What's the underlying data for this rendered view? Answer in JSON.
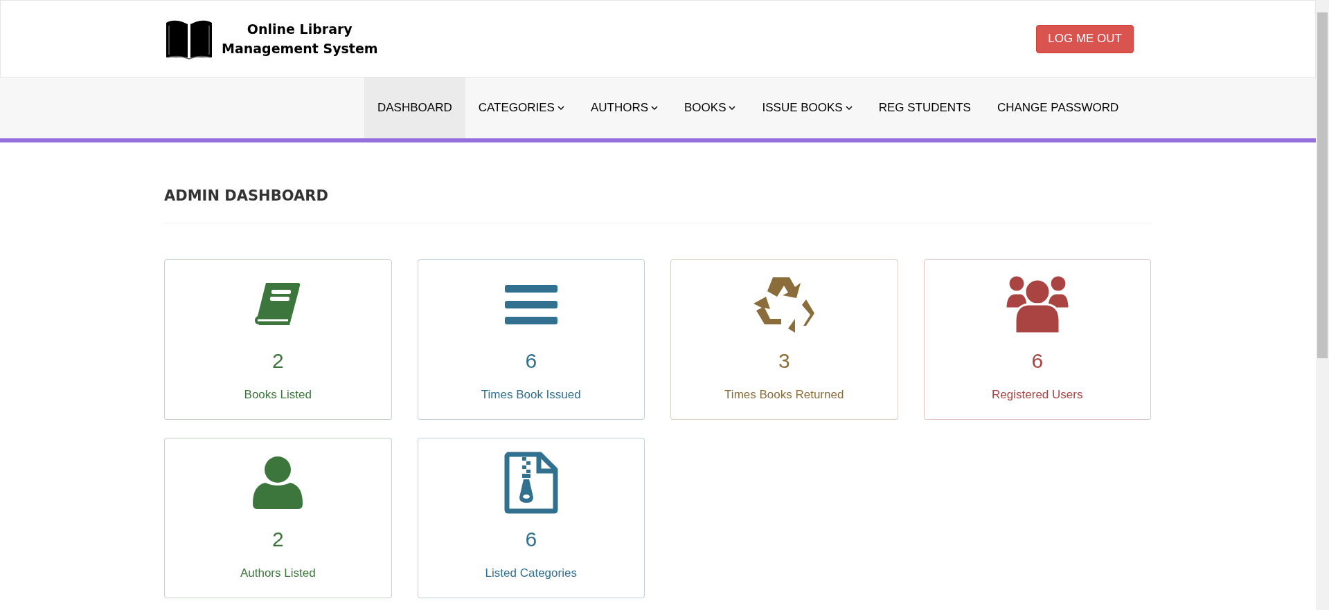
{
  "header": {
    "title_lines": [
      "Online Library",
      "Management System"
    ],
    "logout_button": "LOG ME OUT"
  },
  "nav": [
    {
      "label": "DASHBOARD",
      "selected": true,
      "dropdown": false
    },
    {
      "label": "CATEGORIES",
      "selected": false,
      "dropdown": true
    },
    {
      "label": "AUTHORS",
      "selected": false,
      "dropdown": true
    },
    {
      "label": "BOOKS",
      "selected": false,
      "dropdown": true
    },
    {
      "label": "ISSUE BOOKS",
      "selected": false,
      "dropdown": true
    },
    {
      "label": "REG STUDENTS",
      "selected": false,
      "dropdown": false
    },
    {
      "label": "CHANGE PASSWORD",
      "selected": false,
      "dropdown": false
    }
  ],
  "heading": "ADMIN DASHBOARD",
  "cards": [
    {
      "kind": "book",
      "color": "#3c763d",
      "count": "2",
      "label": "Books Listed"
    },
    {
      "kind": "bars",
      "color": "#31708f",
      "count": "6",
      "label": "Times Book Issued"
    },
    {
      "kind": "recycle",
      "color": "#8a6d3b",
      "count": "3",
      "label": "Times Books Returned"
    },
    {
      "kind": "users",
      "color": "#a94442",
      "count": "6",
      "label": "Registered Users"
    },
    {
      "kind": "user",
      "color": "#3c763d",
      "count": "2",
      "label": "Authors Listed"
    },
    {
      "kind": "zip-file",
      "color": "#31708f",
      "count": "6",
      "label": "Listed Categories"
    }
  ]
}
